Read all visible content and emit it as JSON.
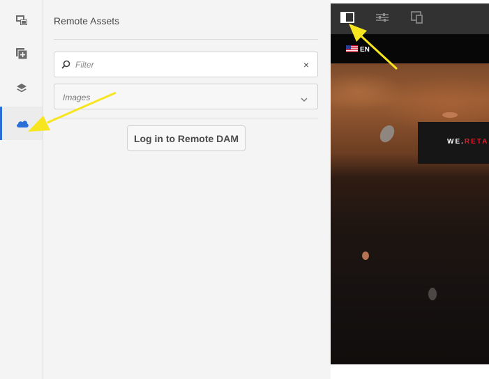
{
  "rail": {
    "items": [
      {
        "name": "assets",
        "active": false
      },
      {
        "name": "components",
        "active": false
      },
      {
        "name": "content-tree",
        "active": false
      },
      {
        "name": "remote-assets",
        "active": true
      }
    ]
  },
  "panel": {
    "title": "Remote Assets",
    "filter": {
      "placeholder": "Filter",
      "value": "",
      "clear_icon": "×"
    },
    "asset_type": {
      "selected": "Images"
    },
    "login_button": "Log in to Remote DAM"
  },
  "editor": {
    "toolbar": [
      "toggle-side-panel",
      "page-properties",
      "emulator"
    ],
    "language": "EN",
    "hero_text_prefix": "WE.",
    "hero_text_highlight": "RETA"
  },
  "colors": {
    "accent": "#2b6fd6",
    "annotation": "#f7e61f",
    "brand_red": "#e11d2c"
  }
}
